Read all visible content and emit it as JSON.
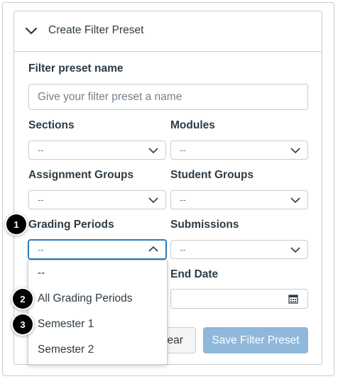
{
  "header": {
    "title": "Create Filter Preset"
  },
  "preset_name": {
    "label": "Filter preset name",
    "placeholder": "Give your filter preset a name"
  },
  "sections": {
    "label": "Sections",
    "value": "--"
  },
  "modules": {
    "label": "Modules",
    "value": "--"
  },
  "assignment_groups": {
    "label": "Assignment Groups",
    "value": "--"
  },
  "student_groups": {
    "label": "Student Groups",
    "value": "--"
  },
  "grading_periods": {
    "label": "Grading Periods",
    "value": "--",
    "options": [
      "--",
      "All Grading Periods",
      "Semester 1",
      "Semester 2"
    ]
  },
  "submissions": {
    "label": "Submissions",
    "value": "--"
  },
  "end_date": {
    "label": "End Date"
  },
  "buttons": {
    "clear": "lear",
    "save": "Save Filter Preset"
  },
  "badges": [
    "1",
    "2",
    "3"
  ],
  "colors": {
    "focus": "#2b7abc",
    "save_button": "#8fb8da",
    "text": "#2d3b45",
    "border": "#c7cdd1"
  }
}
